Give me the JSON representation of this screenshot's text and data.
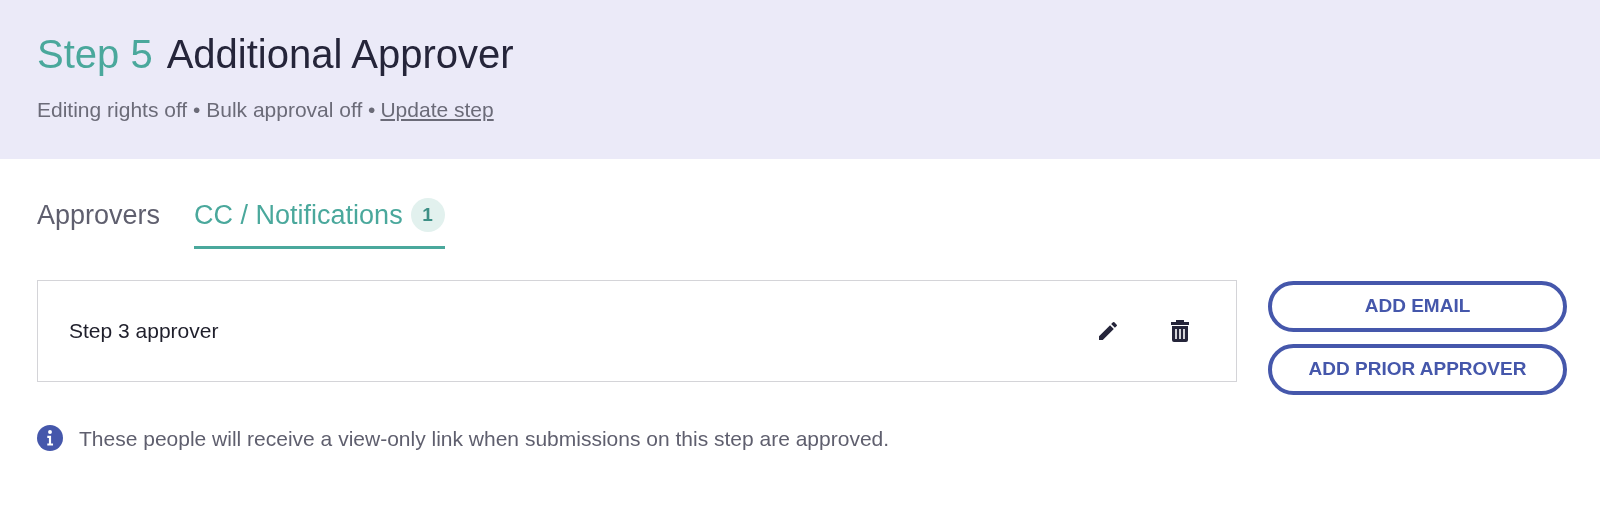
{
  "header": {
    "step_label": "Step 5",
    "title": "Additional Approver",
    "summary": "Editing rights off • Bulk approval off •",
    "link": "Update step"
  },
  "tabs": [
    {
      "label": "Approvers",
      "selected": false
    },
    {
      "label": "CC / Notifications",
      "selected": true,
      "badge": "1"
    }
  ],
  "recipients": [
    {
      "label": "Step 3 approver"
    }
  ],
  "buttons": [
    "ADD EMAIL",
    "ADD PRIOR APPROVER"
  ],
  "info": "These people will receive a view-only link when submissions on this step are approved."
}
